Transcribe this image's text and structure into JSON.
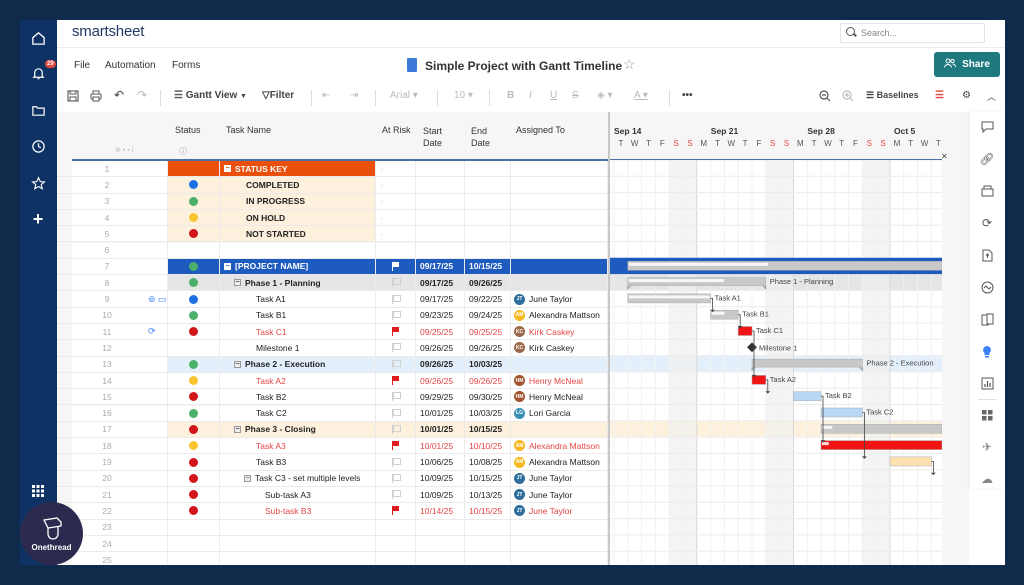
{
  "app": {
    "logo": "smartsheet",
    "search_placeholder": "Search...",
    "notification_count": "29",
    "menu": [
      "File",
      "Automation",
      "Forms"
    ],
    "sheet_title": "Simple Project with Gantt Timeline",
    "share_label": "Share"
  },
  "left_nav": [
    {
      "icon": "home-icon"
    },
    {
      "icon": "bell-icon"
    },
    {
      "icon": "folder-icon"
    },
    {
      "icon": "clock-icon"
    },
    {
      "icon": "star-icon"
    },
    {
      "icon": "plus-icon"
    },
    {
      "icon": "apps-grid-icon"
    }
  ],
  "toolbar": {
    "view_label": "Gantt View",
    "filter_label": "Filter",
    "font": "Arial",
    "font_size": "10",
    "baselines_label": "Baselines"
  },
  "columns": {
    "status": "Status",
    "task_name": "Task Name",
    "at_risk": "At Risk",
    "start_date": "Start Date",
    "end_date": "End Date",
    "assigned_to": "Assigned To"
  },
  "timeline": {
    "weeks": [
      "Sep 14",
      "Sep 21",
      "Sep 28",
      "Oct 5"
    ],
    "days": [
      "T",
      "W",
      "T",
      "F",
      "S",
      "S",
      "M",
      "T",
      "W",
      "T",
      "F",
      "S",
      "S",
      "M",
      "T",
      "W",
      "T",
      "F",
      "S",
      "S",
      "M",
      "T",
      "W",
      "T"
    ],
    "weekend_color": "#e8473f"
  },
  "colors": {
    "completed": "#1f6fe5",
    "in_progress": "#4caf6a",
    "on_hold": "#f9c531",
    "not_started": "#d0161b",
    "status_key_bg": "#e8500c",
    "project_bg": "#1d5bbf",
    "phase1_bg": "#e5e5e5",
    "phase2_bg": "#e3f0fc",
    "phase3_bg": "#fdf1dd",
    "at_risk_text": "#e54545",
    "share_bg": "#1f7a80"
  },
  "rows": [
    {
      "n": "1",
      "type": "statuskey",
      "status": "",
      "name": "STATUS KEY",
      "risk": false,
      "start": "",
      "end": "",
      "assignee": "",
      "initials": "",
      "avcolor": ""
    },
    {
      "n": "2",
      "type": "key",
      "status": "completed",
      "name": "COMPLETED",
      "risk": false,
      "start": "",
      "end": "",
      "assignee": "",
      "initials": "",
      "avcolor": ""
    },
    {
      "n": "3",
      "type": "key",
      "status": "in_progress",
      "name": "IN PROGRESS",
      "risk": false,
      "start": "",
      "end": "",
      "assignee": "",
      "initials": "",
      "avcolor": ""
    },
    {
      "n": "4",
      "type": "key",
      "status": "on_hold",
      "name": "ON HOLD",
      "risk": false,
      "start": "",
      "end": "",
      "assignee": "",
      "initials": "",
      "avcolor": ""
    },
    {
      "n": "5",
      "type": "key",
      "status": "not_started",
      "name": "NOT STARTED",
      "risk": false,
      "start": "",
      "end": "",
      "assignee": "",
      "initials": "",
      "avcolor": ""
    },
    {
      "n": "6",
      "type": "blank",
      "status": "",
      "name": "",
      "risk": false,
      "start": "",
      "end": "",
      "assignee": "",
      "initials": "",
      "avcolor": ""
    },
    {
      "n": "7",
      "type": "project",
      "status": "in_progress",
      "name": "[PROJECT NAME]",
      "risk": true,
      "start": "09/17/25",
      "end": "10/15/25",
      "assignee": "",
      "initials": "",
      "avcolor": ""
    },
    {
      "n": "8",
      "type": "phase1",
      "status": "in_progress",
      "name": "Phase 1 - Planning",
      "risk": false,
      "start": "09/17/25",
      "end": "09/26/25",
      "assignee": "",
      "initials": "",
      "avcolor": ""
    },
    {
      "n": "9",
      "type": "task",
      "status": "completed",
      "name": "Task A1",
      "risk": false,
      "start": "09/17/25",
      "end": "09/22/25",
      "assignee": "June Taylor",
      "initials": "JT",
      "avcolor": "#2e6e9e",
      "indicators": [
        "attachment",
        "comment"
      ]
    },
    {
      "n": "10",
      "type": "task",
      "status": "in_progress",
      "name": "Task B1",
      "risk": false,
      "start": "09/23/25",
      "end": "09/24/25",
      "assignee": "Alexandra Mattson",
      "initials": "AM",
      "avcolor": "#f6b81e"
    },
    {
      "n": "11",
      "type": "task",
      "status": "not_started",
      "name": "Task C1",
      "risk": true,
      "start": "09/25/25",
      "end": "09/25/25",
      "assignee": "Kirk Caskey",
      "initials": "KC",
      "avcolor": "#9a6a4a",
      "indicators": [
        "sync"
      ]
    },
    {
      "n": "12",
      "type": "task",
      "status": "",
      "name": "Milestone 1",
      "risk": false,
      "start": "09/26/25",
      "end": "09/26/25",
      "assignee": "Kirk Caskey",
      "initials": "KC",
      "avcolor": "#9a6a4a"
    },
    {
      "n": "13",
      "type": "phase2",
      "status": "in_progress",
      "name": "Phase 2 - Execution",
      "risk": false,
      "start": "09/26/25",
      "end": "10/03/25",
      "assignee": "",
      "initials": "",
      "avcolor": ""
    },
    {
      "n": "14",
      "type": "task",
      "status": "on_hold",
      "name": "Task A2",
      "risk": true,
      "start": "09/26/25",
      "end": "09/26/25",
      "assignee": "Henry McNeal",
      "initials": "HM",
      "avcolor": "#a0522d"
    },
    {
      "n": "15",
      "type": "task",
      "status": "not_started",
      "name": "Task B2",
      "risk": false,
      "start": "09/29/25",
      "end": "09/30/25",
      "assignee": "Henry McNeal",
      "initials": "HM",
      "avcolor": "#a0522d"
    },
    {
      "n": "16",
      "type": "task",
      "status": "in_progress",
      "name": "Task C2",
      "risk": false,
      "start": "10/01/25",
      "end": "10/03/25",
      "assignee": "Lori Garcia",
      "initials": "LG",
      "avcolor": "#3a8fb7"
    },
    {
      "n": "17",
      "type": "phase3",
      "status": "not_started",
      "name": "Phase 3 - Closing",
      "risk": false,
      "start": "10/01/25",
      "end": "10/15/25",
      "assignee": "",
      "initials": "",
      "avcolor": ""
    },
    {
      "n": "18",
      "type": "task",
      "status": "on_hold",
      "name": "Task A3",
      "risk": true,
      "start": "10/01/25",
      "end": "10/10/25",
      "assignee": "Alexandra Mattson",
      "initials": "AM",
      "avcolor": "#f6b81e"
    },
    {
      "n": "19",
      "type": "task",
      "status": "not_started",
      "name": "Task B3",
      "risk": false,
      "start": "10/06/25",
      "end": "10/08/25",
      "assignee": "Alexandra Mattson",
      "initials": "AM",
      "avcolor": "#f6b81e"
    },
    {
      "n": "20",
      "type": "subparent",
      "status": "not_started",
      "name": "Task C3 - set multiple levels",
      "risk": false,
      "start": "10/09/25",
      "end": "10/15/25",
      "assignee": "June Taylor",
      "initials": "JT",
      "avcolor": "#2e6e9e"
    },
    {
      "n": "21",
      "type": "subtask",
      "status": "not_started",
      "name": "Sub-task A3",
      "risk": false,
      "start": "10/09/25",
      "end": "10/13/25",
      "assignee": "June Taylor",
      "initials": "JT",
      "avcolor": "#2e6e9e"
    },
    {
      "n": "22",
      "type": "subtask",
      "status": "not_started",
      "name": "Sub-task B3",
      "risk": true,
      "start": "10/14/25",
      "end": "10/15/25",
      "assignee": "June Taylor",
      "initials": "JT",
      "avcolor": "#2e6e9e"
    },
    {
      "n": "23",
      "type": "blank",
      "status": "",
      "name": "",
      "risk": false,
      "start": "",
      "end": "",
      "assignee": "",
      "initials": "",
      "avcolor": ""
    },
    {
      "n": "24",
      "type": "blank",
      "status": "",
      "name": "",
      "risk": false,
      "start": "",
      "end": "",
      "assignee": "",
      "initials": "",
      "avcolor": ""
    },
    {
      "n": "25",
      "type": "blank",
      "status": "",
      "name": "",
      "risk": false,
      "start": "",
      "end": "",
      "assignee": "",
      "initials": "",
      "avcolor": ""
    }
  ],
  "gantt_bars": [
    {
      "row": 7,
      "start": "09/17",
      "end": "10/15",
      "color": "#c8c8c8",
      "progress": 0.35,
      "label": ""
    },
    {
      "row": 8,
      "start": "09/17",
      "end": "09/26",
      "color": "#c8c8c8",
      "progress": 0.7,
      "label": "Phase 1 - Planning",
      "summary": true
    },
    {
      "row": 9,
      "start": "09/17",
      "end": "09/22",
      "color": "#c8c8c8",
      "progress": 1,
      "label": "Task A1"
    },
    {
      "row": 10,
      "start": "09/23",
      "end": "09/24",
      "color": "#c8c8c8",
      "progress": 0.5,
      "label": "Task B1"
    },
    {
      "row": 11,
      "start": "09/25",
      "end": "09/25",
      "color": "#f01414",
      "progress": 0,
      "label": "Task C1"
    },
    {
      "row": 12,
      "start": "09/26",
      "end": "09/26",
      "milestone": true,
      "label": "Milestone 1"
    },
    {
      "row": 13,
      "start": "09/26",
      "end": "10/03",
      "color": "#c8c8c8",
      "progress": 0,
      "label": "Phase 2 - Execution",
      "summary": true
    },
    {
      "row": 14,
      "start": "09/26",
      "end": "09/26",
      "color": "#f01414",
      "progress": 0,
      "label": "Task A2"
    },
    {
      "row": 15,
      "start": "09/29",
      "end": "09/30",
      "color": "#b7d7f5",
      "progress": 0,
      "label": "Task B2"
    },
    {
      "row": 16,
      "start": "10/01",
      "end": "10/03",
      "color": "#b7d7f5",
      "progress": 0,
      "label": "Task C2"
    },
    {
      "row": 17,
      "start": "10/01",
      "end": "10/15",
      "color": "#c8c8c8",
      "progress": 0.05,
      "label": ""
    },
    {
      "row": 18,
      "start": "10/01",
      "end": "10/10",
      "color": "#f01414",
      "progress": 0.05,
      "label": ""
    },
    {
      "row": 19,
      "start": "10/06",
      "end": "10/08",
      "color": "#fde2b0",
      "progress": 0,
      "label": ""
    }
  ],
  "watermark": "Onethread"
}
